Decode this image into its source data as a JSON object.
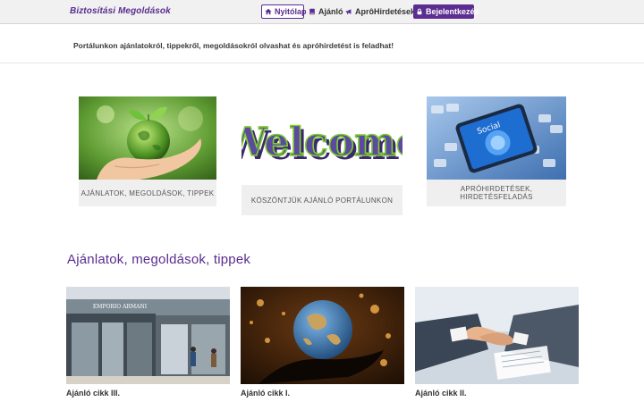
{
  "brand": "Biztosítási Megoldások",
  "nav": {
    "home": "Nyitólap",
    "offers": "Ajánló",
    "ads": "AprôHirdetések",
    "login": "Bejelentkezés"
  },
  "intro": "Portálunkon ajánlatokról, tippekről, megoldásokról olvashat és apróhirdetést is feladhat!",
  "cards": [
    {
      "caption": "AJÁNLATOK, MEGOLDÁSOK, TIPPEK"
    },
    {
      "caption": "KÖSZÖNTJÜK AJÁNLÓ PORTÁLUNKON",
      "image_text": "Welcome"
    },
    {
      "caption": "APRÓHIRDETÉSEK, HIRDETÉSFELADÁS",
      "image_text": "Social"
    }
  ],
  "section_title": "Ajánlatok, megoldások, tippek",
  "articles": [
    {
      "title": "Ajánló cikk III.",
      "image_text": "EMPORIO ARMANI"
    },
    {
      "title": "Ajánló cikk I."
    },
    {
      "title": "Ajánló cikk II."
    }
  ],
  "colors": {
    "accent": "#5b2d90"
  },
  "icons": [
    "home-icon",
    "book-icon",
    "megaphone-icon",
    "lock-icon"
  ]
}
